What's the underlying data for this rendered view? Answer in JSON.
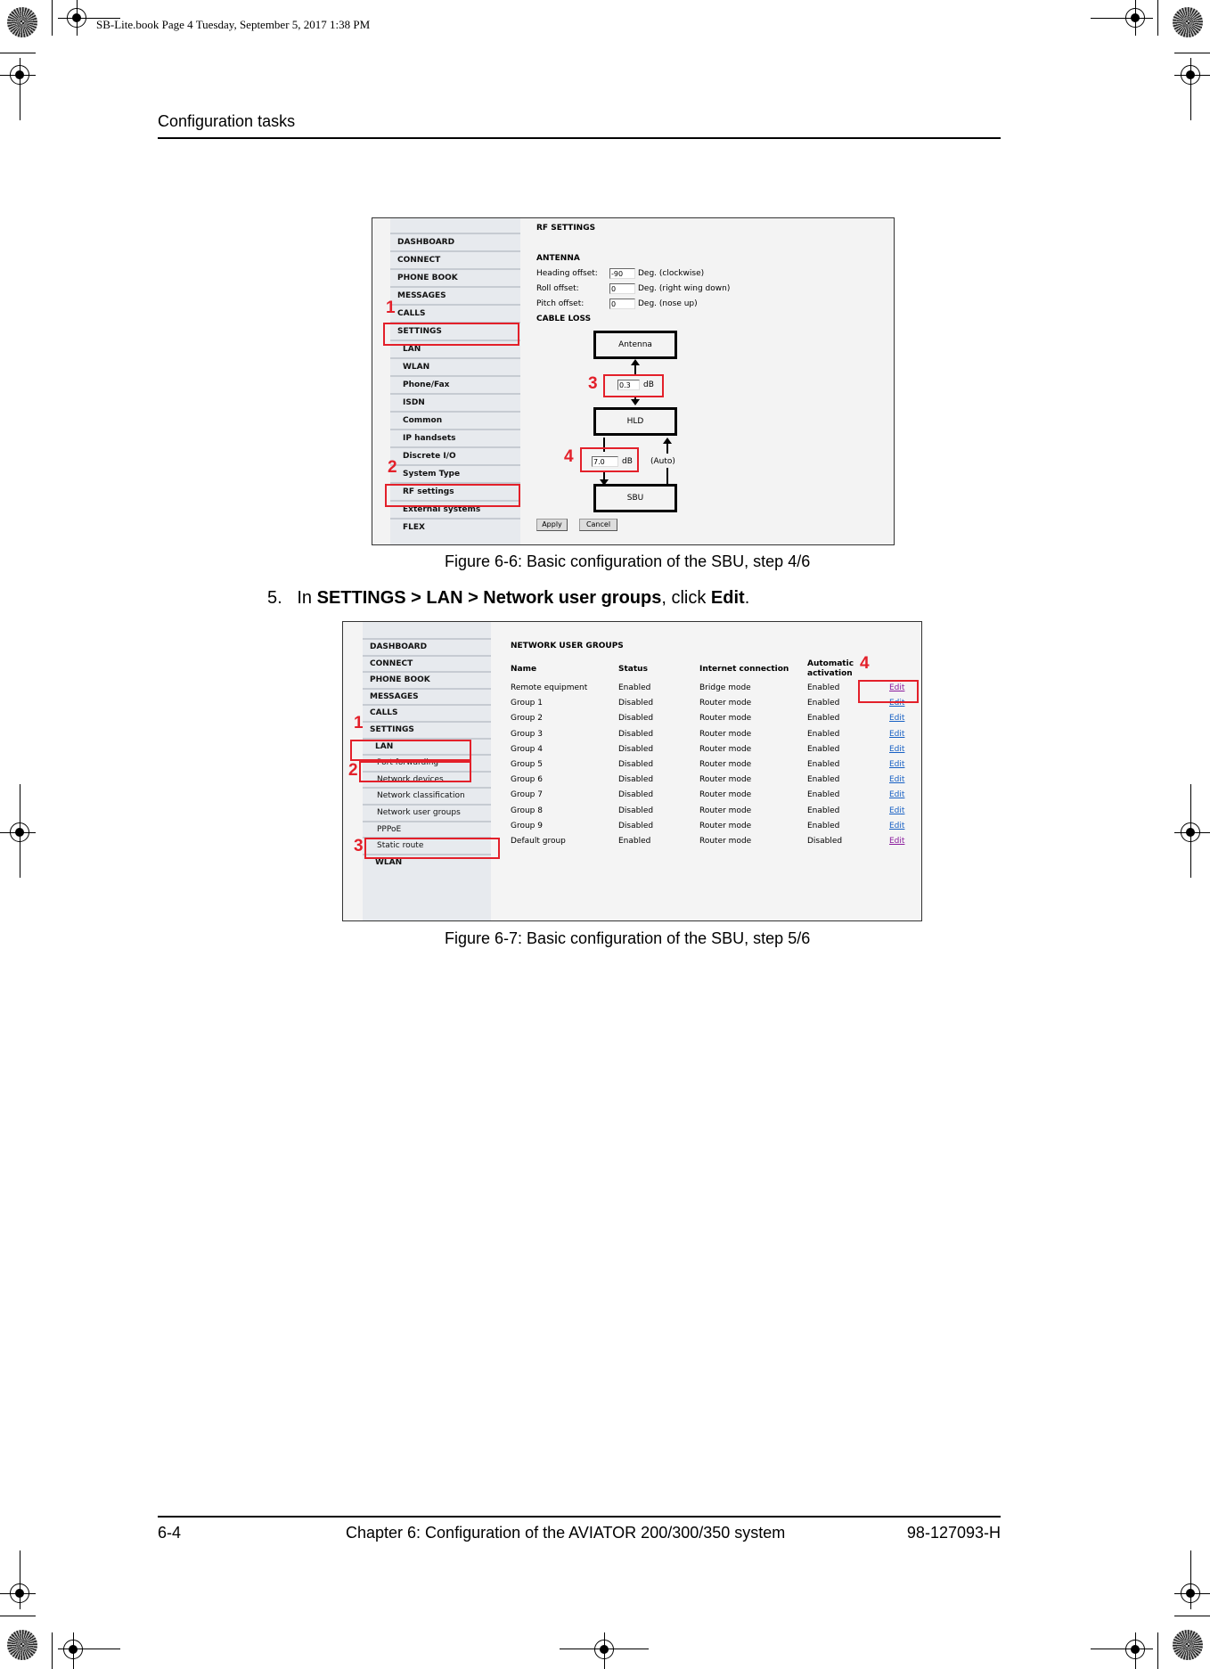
{
  "slug": "SB-Lite.book  Page 4  Tuesday, September 5, 2017  1:38 PM",
  "running_head": "Configuration tasks",
  "figure1": {
    "nav": [
      {
        "label": "DASHBOARD",
        "level": 0
      },
      {
        "label": "CONNECT",
        "level": 0
      },
      {
        "label": "PHONE BOOK",
        "level": 0
      },
      {
        "label": "MESSAGES",
        "level": 0
      },
      {
        "label": "CALLS",
        "level": 0
      },
      {
        "label": "SETTINGS",
        "level": 0
      },
      {
        "label": "LAN",
        "level": 1
      },
      {
        "label": "WLAN",
        "level": 1
      },
      {
        "label": "Phone/Fax",
        "level": 1
      },
      {
        "label": "ISDN",
        "level": 1
      },
      {
        "label": "Common",
        "level": 1
      },
      {
        "label": "IP handsets",
        "level": 1
      },
      {
        "label": "Discrete I/O",
        "level": 1
      },
      {
        "label": "System Type",
        "level": 1
      },
      {
        "label": "RF settings",
        "level": 1
      },
      {
        "label": "External systems",
        "level": 1
      },
      {
        "label": "FLEX",
        "level": 1
      }
    ],
    "page_title": "RF SETTINGS",
    "antenna_heading": "ANTENNA",
    "fields": [
      {
        "label": "Heading offset:",
        "value": "-90",
        "unit": "Deg. (clockwise)"
      },
      {
        "label": "Roll offset:",
        "value": "0",
        "unit": "Deg. (right wing down)"
      },
      {
        "label": "Pitch offset:",
        "value": "0",
        "unit": "Deg. (nose up)"
      }
    ],
    "cable_loss_heading": "CABLE LOSS",
    "diagram": {
      "antenna_label": "Antenna",
      "hld_label": "HLD",
      "sbu_label": "SBU",
      "loss_antenna_hld": "0.3",
      "loss_hld_sbu": "7.0",
      "unit": "dB",
      "auto_label": "(Auto)"
    },
    "apply_label": "Apply",
    "cancel_label": "Cancel",
    "callouts": [
      "1",
      "2",
      "3",
      "4"
    ],
    "caption": "Figure 6-6: Basic configuration of the SBU, step 4/6"
  },
  "step5": {
    "number": "5.",
    "prefix": "In ",
    "path": "SETTINGS > LAN > Network user groups",
    "middle": ", click ",
    "action": "Edit",
    "suffix": "."
  },
  "figure2": {
    "nav": [
      {
        "label": "DASHBOARD",
        "level": 0
      },
      {
        "label": "CONNECT",
        "level": 0
      },
      {
        "label": "PHONE BOOK",
        "level": 0
      },
      {
        "label": "MESSAGES",
        "level": 0
      },
      {
        "label": "CALLS",
        "level": 0
      },
      {
        "label": "SETTINGS",
        "level": 0
      },
      {
        "label": "LAN",
        "level": 1
      },
      {
        "label": "Port forwarding",
        "level": 2
      },
      {
        "label": "Network devices",
        "level": 2
      },
      {
        "label": "Network classification",
        "level": 2
      },
      {
        "label": "Network user groups",
        "level": 2
      },
      {
        "label": "PPPoE",
        "level": 2
      },
      {
        "label": "Static route",
        "level": 2
      },
      {
        "label": "WLAN",
        "level": 1
      }
    ],
    "page_title": "NETWORK USER GROUPS",
    "columns": [
      "Name",
      "Status",
      "Internet connection",
      "Automatic activation"
    ],
    "rows": [
      {
        "name": "Remote equipment",
        "status": "Enabled",
        "connection": "Bridge mode",
        "activation": "Enabled",
        "action": "Edit",
        "visited": true
      },
      {
        "name": "Group 1",
        "status": "Disabled",
        "connection": "Router mode",
        "activation": "Enabled",
        "action": "Edit",
        "visited": false
      },
      {
        "name": "Group 2",
        "status": "Disabled",
        "connection": "Router mode",
        "activation": "Enabled",
        "action": "Edit",
        "visited": false
      },
      {
        "name": "Group 3",
        "status": "Disabled",
        "connection": "Router mode",
        "activation": "Enabled",
        "action": "Edit",
        "visited": false
      },
      {
        "name": "Group 4",
        "status": "Disabled",
        "connection": "Router mode",
        "activation": "Enabled",
        "action": "Edit",
        "visited": false
      },
      {
        "name": "Group 5",
        "status": "Disabled",
        "connection": "Router mode",
        "activation": "Enabled",
        "action": "Edit",
        "visited": false
      },
      {
        "name": "Group 6",
        "status": "Disabled",
        "connection": "Router mode",
        "activation": "Enabled",
        "action": "Edit",
        "visited": false
      },
      {
        "name": "Group 7",
        "status": "Disabled",
        "connection": "Router mode",
        "activation": "Enabled",
        "action": "Edit",
        "visited": false
      },
      {
        "name": "Group 8",
        "status": "Disabled",
        "connection": "Router mode",
        "activation": "Enabled",
        "action": "Edit",
        "visited": false
      },
      {
        "name": "Group 9",
        "status": "Disabled",
        "connection": "Router mode",
        "activation": "Enabled",
        "action": "Edit",
        "visited": false
      },
      {
        "name": "Default group",
        "status": "Enabled",
        "connection": "Router mode",
        "activation": "Disabled",
        "action": "Edit",
        "visited": true
      }
    ],
    "callouts": [
      "1",
      "2",
      "3",
      "4"
    ],
    "caption": "Figure 6-7: Basic configuration of the SBU, step 5/6"
  },
  "footer": {
    "page_number": "6-4",
    "chapter": "Chapter 6:  Configuration of the AVIATOR 200/300/350 system",
    "doc_number": "98-127093-H"
  },
  "colors": {
    "callout_red": "#e3202a",
    "link_blue": "#1760c4",
    "link_visited": "#8a1a9c"
  }
}
